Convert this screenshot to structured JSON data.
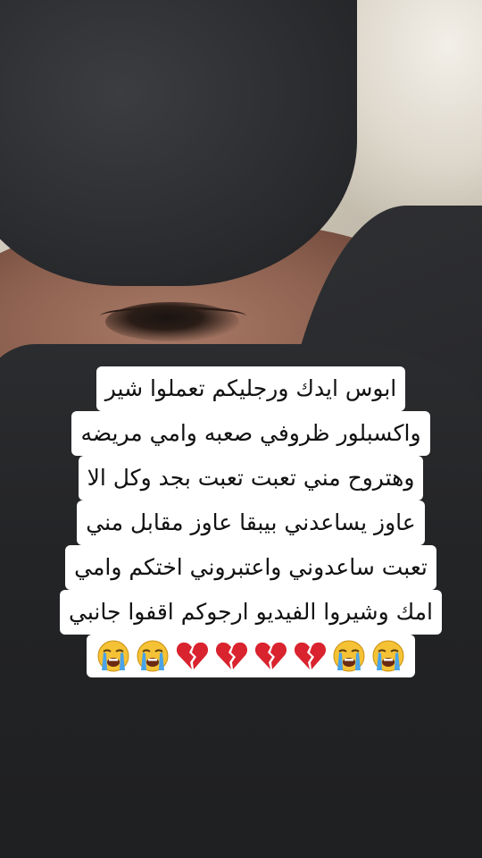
{
  "caption": {
    "lines": [
      "ابوس ايدك ورجليكم تعملوا شير",
      "واكسبلور ظروفي صعبه وامي مريضه",
      "وهتروح مني تعبت تعبت بجد وكل الا",
      "عاوز يساعدني بيبقا عاوز مقابل مني",
      "تعبت ساعدوني واعتبروني اختكم وامي",
      "امك وشيروا الفيديو ارجوكم اقفوا جانبي"
    ],
    "emojis": [
      "loudly-crying-face",
      "loudly-crying-face",
      "broken-heart",
      "broken-heart",
      "broken-heart",
      "broken-heart",
      "loudly-crying-face",
      "loudly-crying-face"
    ]
  },
  "colors": {
    "caption_bg": "#ffffff",
    "caption_text": "#111111",
    "heart": "#d9232e",
    "emoji_face": "#f5c235",
    "tears": "#4aa3e8"
  }
}
